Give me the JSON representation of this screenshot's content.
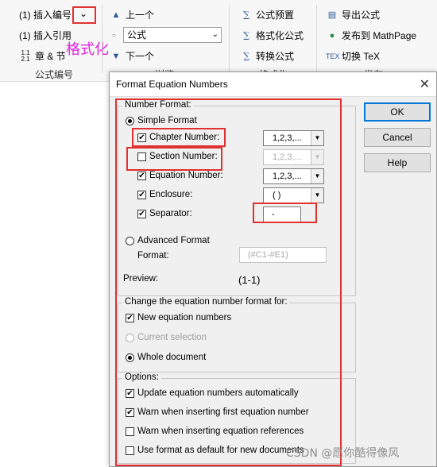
{
  "ribbon": {
    "col1": {
      "insert_number": "(1) 插入编号",
      "insert_reference": "(1) 插入引用",
      "chapter_section": "章 & 节",
      "group_label": "公式编号"
    },
    "col2": {
      "prev": "上一个",
      "dropdown_value": "公式",
      "next": "下一个",
      "group_label": "浏览"
    },
    "col3": {
      "preset": "公式预置",
      "format_eq": "格式化公式",
      "convert_eq": "转换公式",
      "group_label": "格式化"
    },
    "col4": {
      "export": "导出公式",
      "publish": "发布到 MathPage",
      "toggle_tex": "切换 TeX",
      "group_label": "发布"
    },
    "annotation": "格式化",
    "icons": {
      "up": "▲",
      "down": "▼",
      "dropdown_arrow": "⌄"
    }
  },
  "dialog": {
    "title": "Format Equation Numbers",
    "buttons": {
      "ok": "OK",
      "cancel": "Cancel",
      "help": "Help"
    },
    "number_format": {
      "legend": "Number Format:",
      "simple_format": "Simple Format",
      "chapter_number": "Chapter Number:",
      "chapter_value": "1,2,3,...",
      "section_number": "Section Number:",
      "section_value": "1,2,3,...",
      "equation_number": "Equation Number:",
      "equation_value": "1,2,3,...",
      "enclosure": "Enclosure:",
      "enclosure_value": "( )",
      "separator": "Separator:",
      "separator_value": "-",
      "advanced_format": "Advanced Format",
      "format_label": "Format:",
      "format_value": "(#C1-#E1)",
      "preview_label": "Preview:",
      "preview_value": "(1-1)"
    },
    "change_for": {
      "legend": "Change the equation number format for:",
      "new_equations": "New equation numbers",
      "current_selection": "Current selection",
      "whole_document": "Whole document"
    },
    "options": {
      "legend": "Options:",
      "opt1": "Update equation numbers automatically",
      "opt2": "Warn when inserting first equation number",
      "opt3": "Warn when inserting equation references",
      "opt4": "Use format as default for new documents"
    }
  },
  "watermark": "CSDN @愿你酷得像风",
  "colors": {
    "highlight": "#e03030",
    "annotation": "#e020e0",
    "accent": "#0078d7"
  }
}
